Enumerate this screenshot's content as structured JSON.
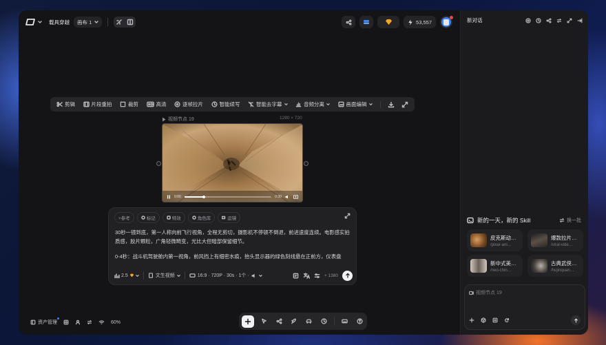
{
  "header": {
    "project_name": "载具穿越",
    "canvas_tab": "画布 1",
    "credits": "53,557"
  },
  "toolbar": {
    "items": [
      {
        "label": "剪辑",
        "icon": "scissors-icon"
      },
      {
        "label": "片段重拍",
        "icon": "film-icon"
      },
      {
        "label": "裁剪",
        "icon": "crop-icon"
      },
      {
        "label": "高清",
        "icon": "hd-icon"
      },
      {
        "label": "逐帧拉片",
        "icon": "frames-icon"
      },
      {
        "label": "智能续写",
        "icon": "continue-icon"
      },
      {
        "label": "智能去字幕",
        "icon": "remove-subtitle-icon"
      },
      {
        "label": "音频分离",
        "icon": "audio-split-icon"
      },
      {
        "label": "画面编辑",
        "icon": "edit-frame-icon"
      }
    ]
  },
  "video_node": {
    "title": "视频节点 19",
    "resolution": "1280 × 720",
    "time_start": "0:00",
    "time_end": "0:30",
    "progress": 0.22
  },
  "prompt": {
    "chips": [
      "+参考",
      "标记",
      "特效",
      "角色库",
      "运镜"
    ],
    "text_line1": "30秒一镜到底，第一人称向前飞行视角，全程无剪切，摄影机不停顿不倒退，前进速度连续。电影感实拍质感，胶片颗粒，广角轻微畸变，光比大但暗部保留细节。",
    "text_line2": "0-4秒：战斗机驾驶舱内第一视角，前风挡上有细密水痕，抬头显示器的绿色刻线悬在正前方，仪表盘",
    "model_version": "2.5",
    "mode": "文生视频",
    "settings": "16:9 · 720P · 30s · 1个 ·",
    "cost": "+ 1380"
  },
  "bottom_bar": {
    "asset_manager": "资产管理",
    "zoom": "60%"
  },
  "side_panel": {
    "title": "新对话",
    "skills_heading": "新的一天，新的 Skill",
    "refresh_label": "换一批",
    "skills": [
      {
        "title": "皮克斯动…",
        "sub": "/pixar-ani…"
      },
      {
        "title": "爆款拉片…",
        "sub": "/viral-vide…"
      },
      {
        "title": "新中式美…",
        "sub": "/neo-chin…"
      },
      {
        "title": "古典武侠…",
        "sub": "/hujinquan…"
      }
    ],
    "input_ref": "视频节点 19"
  },
  "colors": {
    "accent_orange": "#f5a623",
    "accent_blue": "#3b82f6",
    "window_bg": "#151517"
  }
}
